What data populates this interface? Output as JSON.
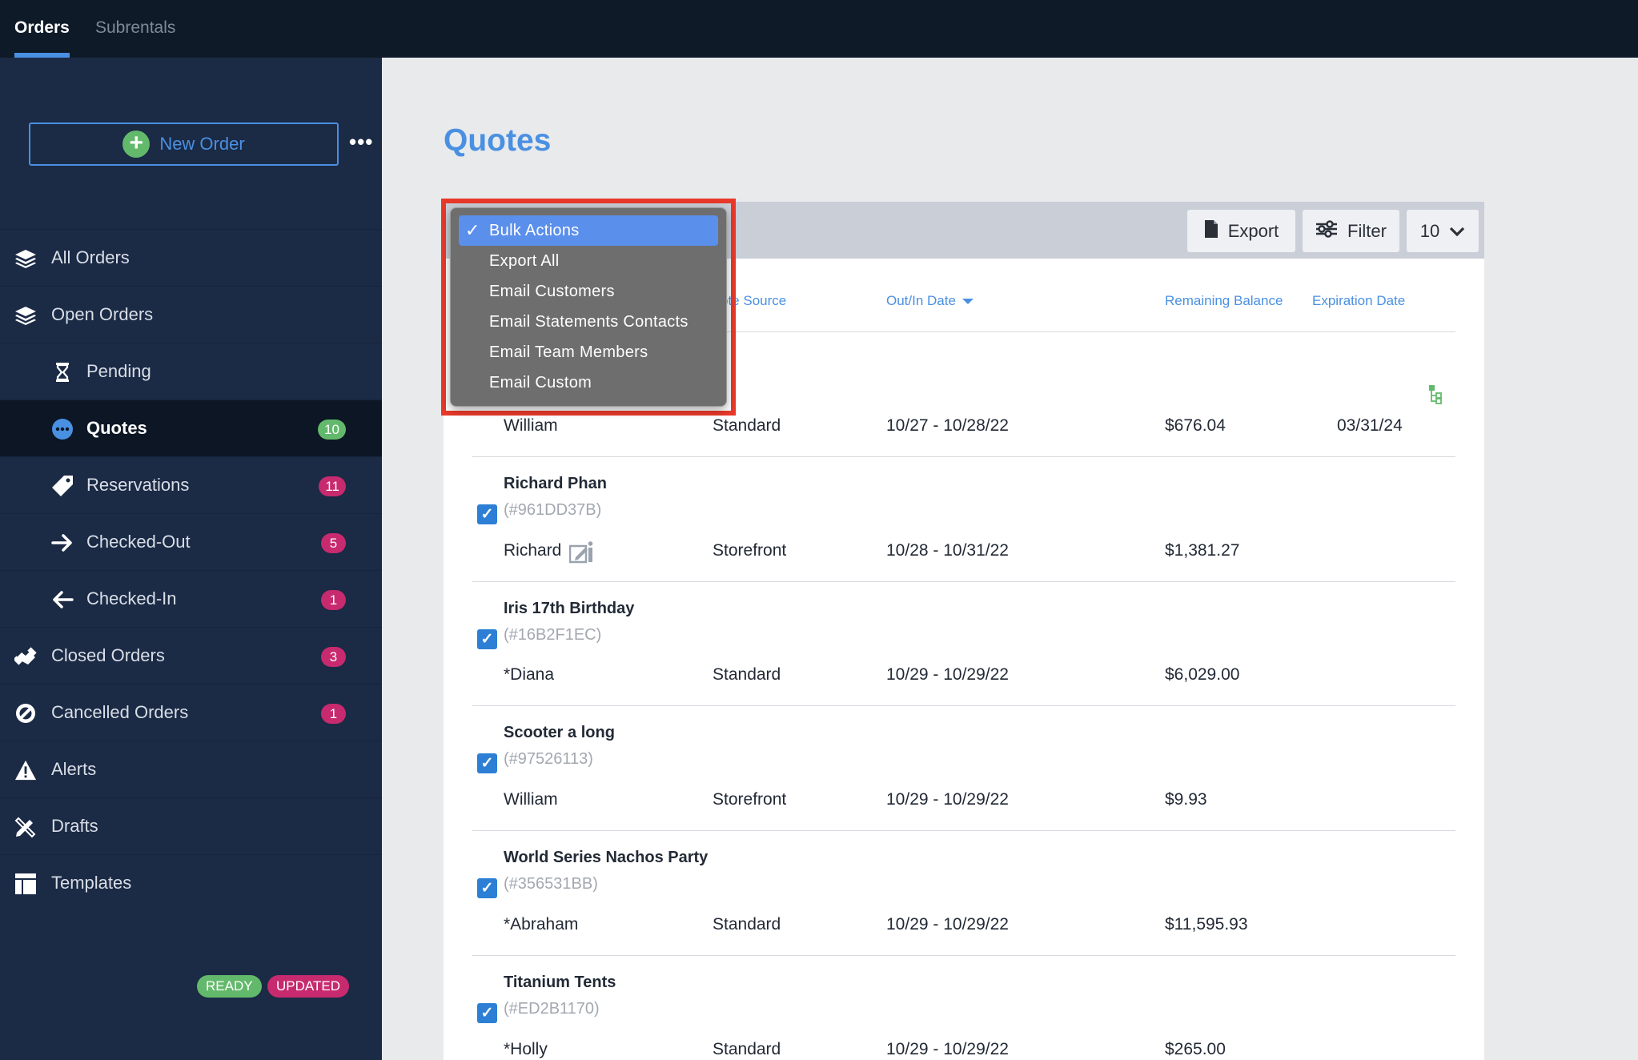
{
  "topbar": {
    "tabs": [
      {
        "label": "Orders",
        "active": true
      },
      {
        "label": "Subrentals",
        "active": false
      }
    ]
  },
  "sidebar": {
    "new_order_label": "New Order",
    "more_label": "•••",
    "items": [
      {
        "label": "All Orders",
        "icon": "layers-icon"
      },
      {
        "label": "Open Orders",
        "icon": "layers-icon"
      },
      {
        "label": "Pending",
        "icon": "hourglass-icon"
      },
      {
        "label": "Quotes",
        "icon": "dots-circle-icon",
        "badge": "10"
      },
      {
        "label": "Reservations",
        "icon": "tag-icon",
        "badge": "11"
      },
      {
        "label": "Checked-Out",
        "icon": "arrow-right-icon",
        "badge": "5"
      },
      {
        "label": "Checked-In",
        "icon": "arrow-left-icon",
        "badge": "1"
      },
      {
        "label": "Closed Orders",
        "icon": "handshake-icon",
        "badge": "3"
      },
      {
        "label": "Cancelled Orders",
        "icon": "ban-icon",
        "badge": "1"
      },
      {
        "label": "Alerts",
        "icon": "warning-icon"
      },
      {
        "label": "Drafts",
        "icon": "pencil-ruler-icon"
      },
      {
        "label": "Templates",
        "icon": "layout-icon"
      }
    ],
    "status": {
      "ready": "READY",
      "updated": "UPDATED"
    }
  },
  "main": {
    "title": "Quotes",
    "toolbar": {
      "export_label": "Export",
      "filter_label": "Filter",
      "per_page": "10"
    },
    "columns": {
      "quote_source": "ote Source",
      "out_in_date": "Out/In Date",
      "remaining_balance": "Remaining Balance",
      "expiration_date": "Expiration Date"
    },
    "rows": [
      {
        "name": "",
        "id": "",
        "customer": "William",
        "source": "Standard",
        "dates": "10/27 - 10/28/22",
        "balance": "$676.04",
        "expiration": "03/31/24"
      },
      {
        "name": "Richard Phan",
        "id": "(#961DD37B)",
        "customer": "Richard",
        "source": "Storefront",
        "dates": "10/28 - 10/31/22",
        "balance": "$1,381.27",
        "expiration": ""
      },
      {
        "name": "Iris 17th Birthday",
        "id": "(#16B2F1EC)",
        "customer": "*Diana",
        "source": "Standard",
        "dates": "10/29 - 10/29/22",
        "balance": "$6,029.00",
        "expiration": ""
      },
      {
        "name": "Scooter a long",
        "id": "(#97526113)",
        "customer": "William",
        "source": "Storefront",
        "dates": "10/29 - 10/29/22",
        "balance": "$9.93",
        "expiration": ""
      },
      {
        "name": "World Series Nachos Party",
        "id": "(#356531BB)",
        "customer": "*Abraham",
        "source": "Standard",
        "dates": "10/29 - 10/29/22",
        "balance": "$11,595.93",
        "expiration": ""
      },
      {
        "name": "Titanium Tents",
        "id": "(#ED2B1170)",
        "customer": "*Holly",
        "source": "Standard",
        "dates": "10/29 - 10/29/22",
        "balance": "$265.00",
        "expiration": ""
      }
    ]
  },
  "dropdown": {
    "options": [
      "Bulk Actions",
      "Export All",
      "Email Customers",
      "Email Statements Contacts",
      "Email Team Members",
      "Email Custom"
    ],
    "selected": "Bulk Actions"
  },
  "colors": {
    "accent": "#4a90e2",
    "sidebar": "#1b2a45",
    "badge_pink": "#c72a6e",
    "badge_green": "#63b96b",
    "highlight": "#e8392a"
  }
}
